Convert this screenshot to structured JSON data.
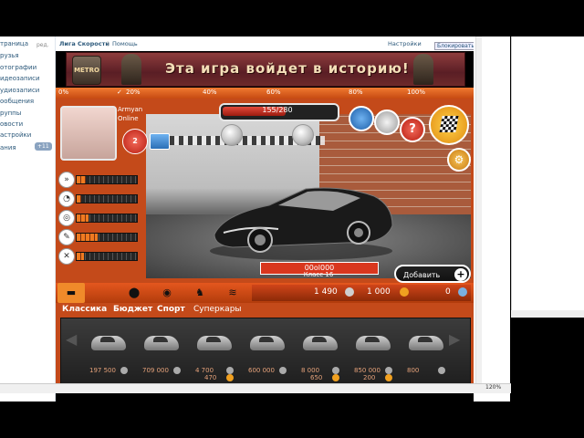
{
  "sidebar": {
    "items": [
      "траница",
      "рузья",
      "отографии",
      "идеозаписи",
      "удиозаписи",
      "ообщения",
      "руппы",
      "овости",
      "астройки",
      "ания"
    ],
    "rd": "ред.",
    "badge": "+11"
  },
  "topbar": {
    "app_link": "Лига Скорости",
    "separator": "|",
    "help_link": "Помощь",
    "settings_link": "Настройки",
    "block_button": "Блокировать"
  },
  "banner": {
    "logo_text": "METRO 2033",
    "text": "Эта игра войдет в историю!"
  },
  "progress": {
    "marks": [
      "0%",
      "20%",
      "40%",
      "60%",
      "80%",
      "100%"
    ],
    "checked_index": 1
  },
  "player": {
    "name": "Armyan",
    "status": "Online",
    "level": "2"
  },
  "xp": {
    "current": 155,
    "max": 280,
    "text": "155/280"
  },
  "stats": [
    {
      "icon": "speed-icon",
      "glyph": "»",
      "level": 0.15
    },
    {
      "icon": "gauge-icon",
      "glyph": "◔",
      "level": 0.08
    },
    {
      "icon": "steering-icon",
      "glyph": "◎",
      "level": 0.2
    },
    {
      "icon": "wrench-icon",
      "glyph": "✎",
      "level": 0.35
    },
    {
      "icon": "tire-icon",
      "glyph": "✕",
      "level": 0.12
    }
  ],
  "car": {
    "plate": "00ol000",
    "class_label": "Класс 16"
  },
  "actions": {
    "add_label": "Добавить",
    "plus_glyph": "+",
    "gear_glyph": "⚙",
    "help_glyph": "?"
  },
  "money": {
    "silver": "1 490",
    "gold": "1 000",
    "other": "0"
  },
  "toolbar": {
    "icons": [
      "garage-car-icon",
      "tire-shop-icon",
      "eye-icon",
      "mechanic-icon",
      "tuning-icon",
      "house-icon"
    ],
    "glyphs": [
      "▬",
      "⬤",
      "◉",
      "♞",
      "≋",
      "⌂"
    ]
  },
  "categories": [
    {
      "label": "Классика",
      "selected": true
    },
    {
      "label": "Бюджет",
      "selected": true
    },
    {
      "label": "Спорт",
      "selected": true
    },
    {
      "label": "Суперкары",
      "selected": false
    }
  ],
  "shop_cars": [
    {
      "price1": "197 500",
      "price2": ""
    },
    {
      "price1": "709 000",
      "price2": ""
    },
    {
      "price1": "4 700",
      "price2": "470"
    },
    {
      "price1": "600 000",
      "price2": ""
    },
    {
      "price1": "8 000",
      "price2": "650"
    },
    {
      "price1": "850 000",
      "price2": "200"
    },
    {
      "price1": "800",
      "price2": ""
    }
  ],
  "status": {
    "zoom": "120%"
  },
  "colors": {
    "frame_orange": "#c44a1a",
    "accent_red": "#d9371e",
    "banner_red": "#5a1e25",
    "link_blue": "#2b587a"
  }
}
